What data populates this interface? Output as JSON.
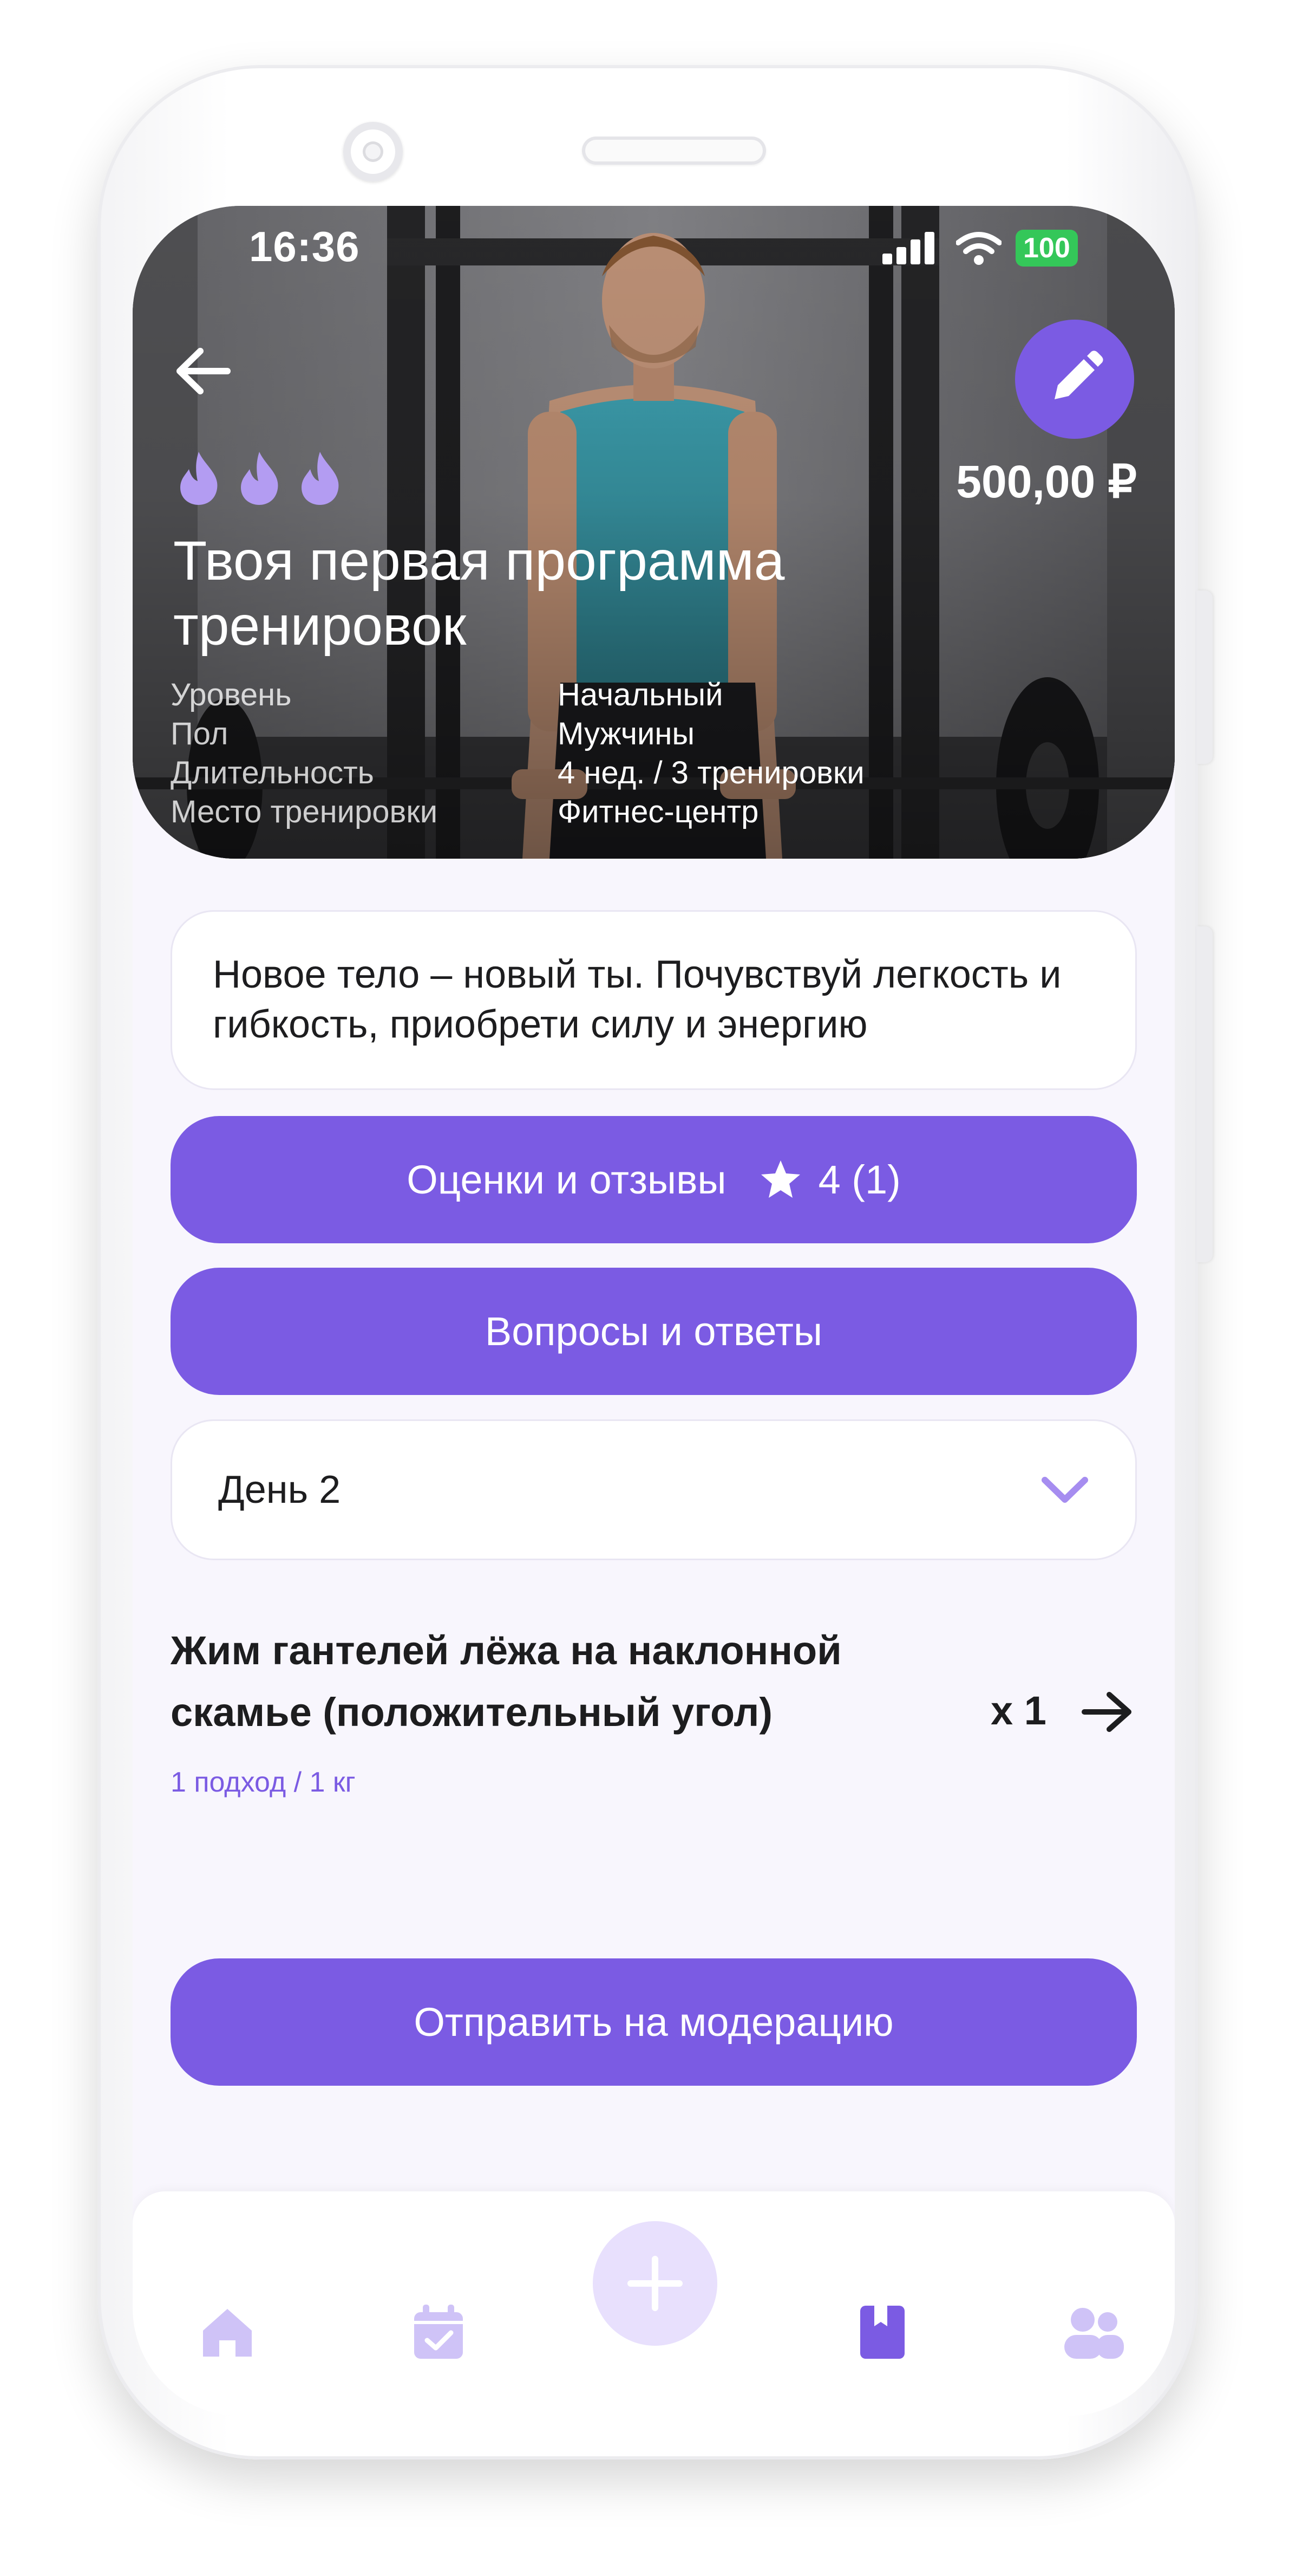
{
  "status_bar": {
    "time": "16:36",
    "battery": "100"
  },
  "hero": {
    "price": "500,00 ₽",
    "title": "Твоя первая программа тренировок",
    "difficulty_level": 3,
    "specs": [
      {
        "label": "Уровень",
        "value": "Начальный"
      },
      {
        "label": "Пол",
        "value": "Мужчины"
      },
      {
        "label": "Длительность",
        "value": "4 нед. / 3 тренировки"
      },
      {
        "label": "Место тренировки",
        "value": "Фитнес-центр"
      }
    ]
  },
  "description": "Новое тело – новый ты. Почувствуй легкость и гибкость, приобрети силу и энергию",
  "reviews_button": {
    "label": "Оценки и отзывы",
    "rating": "4 (1)"
  },
  "qa_button": {
    "label": "Вопросы и ответы"
  },
  "day_select": {
    "value": "День 2"
  },
  "exercise": {
    "name": "Жим гантелей лёжа на наклонной скамье (положительный угол)",
    "reps": "x 1",
    "details": "1 подход / 1 кг"
  },
  "submit_button": {
    "label": "Отправить на модерацию"
  },
  "colors": {
    "accent": "#7b5be3",
    "accent_light": "#e8e0fd",
    "nav_inactive": "#cfc3f7",
    "background": "#f8f6fd"
  },
  "icons": {
    "back": "arrow-left-icon",
    "edit": "pencil-icon",
    "star": "star-icon",
    "chevron": "chevron-down-icon",
    "arrow": "arrow-right-icon",
    "home": "home-icon",
    "calendar": "calendar-check-icon",
    "add": "plus-icon",
    "bookmark": "bookmark-icon",
    "users": "users-icon"
  }
}
